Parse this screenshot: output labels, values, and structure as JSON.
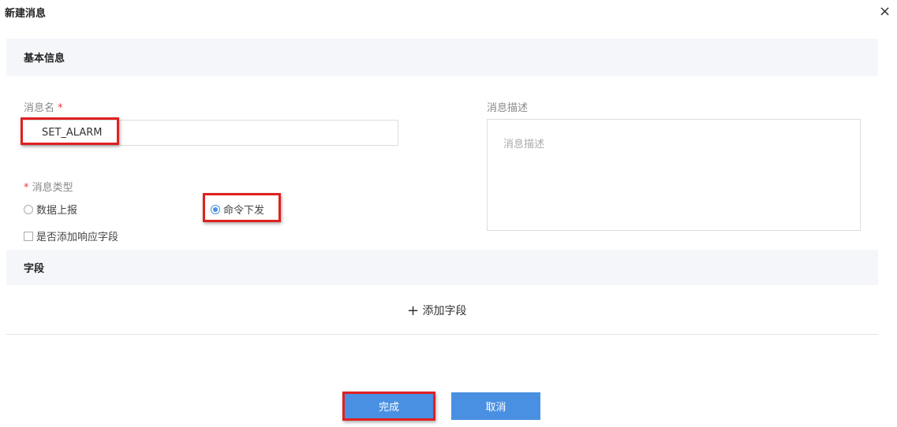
{
  "dialog": {
    "title": "新建消息",
    "close_icon": "×"
  },
  "basic_section": {
    "title": "基本信息"
  },
  "message_name": {
    "label": "消息名",
    "required_mark": "*",
    "value": "SET_ALARM"
  },
  "message_description": {
    "label": "消息描述",
    "placeholder": "消息描述"
  },
  "message_type": {
    "required_mark": "*",
    "label": "消息类型",
    "options": [
      {
        "label": "数据上报",
        "selected": false
      },
      {
        "label": "命令下发",
        "selected": true
      }
    ]
  },
  "add_response_field": {
    "label": "是否添加响应字段",
    "checked": false
  },
  "fields_section": {
    "title": "字段",
    "add_label": "添加字段",
    "add_icon": "+"
  },
  "buttons": {
    "confirm": "完成",
    "cancel": "取消"
  },
  "colors": {
    "primary": "#4a90e2",
    "highlight": "#e02020"
  }
}
